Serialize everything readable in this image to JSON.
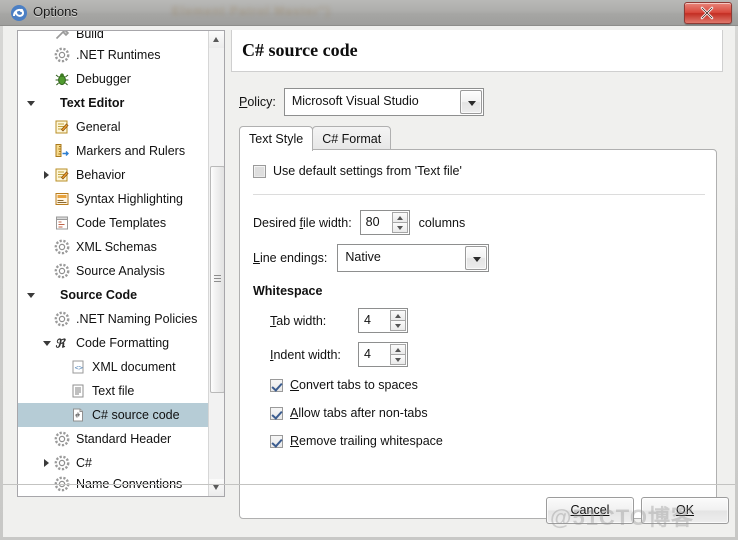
{
  "window": {
    "title": "Options",
    "app_icon": "monodevelop-icon",
    "ghost_text": "Element Patrol Master\")",
    "close_label": "x"
  },
  "sidebar": {
    "items": [
      {
        "label": "Build",
        "icon": "build-icon",
        "indent": 1,
        "twisty": "none",
        "bold": false,
        "selected": false,
        "clipped": true
      },
      {
        "label": ".NET Runtimes",
        "icon": "gear-icon",
        "indent": 1,
        "twisty": "none",
        "bold": false,
        "selected": false
      },
      {
        "label": "Debugger",
        "icon": "bug-icon",
        "indent": 1,
        "twisty": "none",
        "bold": false,
        "selected": false
      },
      {
        "label": "Text Editor",
        "icon": "none",
        "indent": 0,
        "twisty": "open",
        "bold": true,
        "selected": false
      },
      {
        "label": "General",
        "icon": "pencil-note-icon",
        "indent": 1,
        "twisty": "none",
        "bold": false,
        "selected": false
      },
      {
        "label": "Markers and Rulers",
        "icon": "ruler-icon",
        "indent": 1,
        "twisty": "none",
        "bold": false,
        "selected": false
      },
      {
        "label": "Behavior",
        "icon": "pencil-note-icon",
        "indent": 1,
        "twisty": "closed",
        "bold": false,
        "selected": false
      },
      {
        "label": "Syntax Highlighting",
        "icon": "syntax-icon",
        "indent": 1,
        "twisty": "none",
        "bold": false,
        "selected": false
      },
      {
        "label": "Code Templates",
        "icon": "template-icon",
        "indent": 1,
        "twisty": "none",
        "bold": false,
        "selected": false
      },
      {
        "label": "XML Schemas",
        "icon": "gear-icon",
        "indent": 1,
        "twisty": "none",
        "bold": false,
        "selected": false
      },
      {
        "label": "Source Analysis",
        "icon": "gear-icon",
        "indent": 1,
        "twisty": "none",
        "bold": false,
        "selected": false
      },
      {
        "label": "Source Code",
        "icon": "none",
        "indent": 0,
        "twisty": "open",
        "bold": true,
        "selected": false
      },
      {
        "label": ".NET Naming Policies",
        "icon": "gear-icon",
        "indent": 1,
        "twisty": "none",
        "bold": false,
        "selected": false
      },
      {
        "label": "Code Formatting",
        "icon": "code-format-icon",
        "indent": 1,
        "twisty": "open",
        "bold": false,
        "selected": false
      },
      {
        "label": "XML document",
        "icon": "xml-doc-icon",
        "indent": 2,
        "twisty": "none",
        "bold": false,
        "selected": false
      },
      {
        "label": "Text file",
        "icon": "text-file-icon",
        "indent": 2,
        "twisty": "none",
        "bold": false,
        "selected": false
      },
      {
        "label": "C# source code",
        "icon": "csharp-file-icon",
        "indent": 2,
        "twisty": "none",
        "bold": false,
        "selected": true
      },
      {
        "label": "Standard Header",
        "icon": "gear-icon",
        "indent": 1,
        "twisty": "none",
        "bold": false,
        "selected": false
      },
      {
        "label": "C#",
        "icon": "gear-icon",
        "indent": 1,
        "twisty": "closed",
        "bold": false,
        "selected": false
      },
      {
        "label": "Name Conventions",
        "icon": "gear-icon",
        "indent": 1,
        "twisty": "none",
        "bold": false,
        "selected": false,
        "clipped": true
      }
    ],
    "selected_color": "#b6ccd6"
  },
  "panel": {
    "heading": "C# source code",
    "policy_label": "Policy:",
    "policy_value": "Microsoft Visual Studio",
    "tabs": [
      {
        "label": "Text Style",
        "active": true
      },
      {
        "label": "C# Format",
        "active": false
      }
    ],
    "use_default": {
      "label": "Use default settings from 'Text file'",
      "checked": false
    },
    "desired_file_width": {
      "label": "Desired file width:",
      "value": "80",
      "suffix": "columns"
    },
    "line_endings": {
      "label": "Line endings:",
      "value": "Native"
    },
    "whitespace": {
      "title": "Whitespace",
      "tab_width": {
        "label": "Tab width:",
        "value": "4"
      },
      "indent_width": {
        "label": "Indent width:",
        "value": "4"
      },
      "checkboxes": [
        {
          "label": "Convert tabs to spaces",
          "checked": true
        },
        {
          "label": "Allow tabs after non-tabs",
          "checked": true
        },
        {
          "label": "Remove trailing whitespace",
          "checked": true
        }
      ]
    }
  },
  "footer": {
    "cancel_label": "Cancel",
    "ok_label": "OK"
  },
  "watermark": "@51CTO博客"
}
